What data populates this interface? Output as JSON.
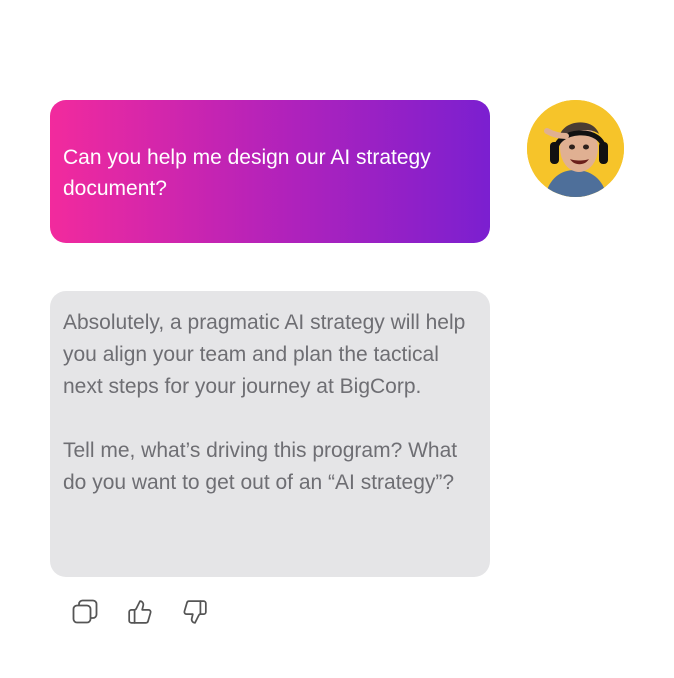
{
  "conversation": {
    "user_message": "Can you help me design our AI strategy document?",
    "user_avatar_icon": "user-avatar-photo",
    "assistant_message": {
      "paragraph_1": "Absolutely, a pragmatic AI strategy will help you align your team and plan the tactical next steps for your journey at BigCorp.",
      "paragraph_2": "Tell me, what’s driving this program? What do you want to get out of an “AI strategy”?"
    }
  },
  "actions": [
    {
      "icon": "copy-icon"
    },
    {
      "icon": "thumbs-up-icon"
    },
    {
      "icon": "thumbs-down-icon"
    }
  ],
  "colors": {
    "user_gradient_start": "#f22a9d",
    "user_gradient_end": "#7b1fd0",
    "assistant_bubble": "#e5e5e7",
    "assistant_text": "#6e6e73",
    "avatar_background": "#f6c42a"
  }
}
